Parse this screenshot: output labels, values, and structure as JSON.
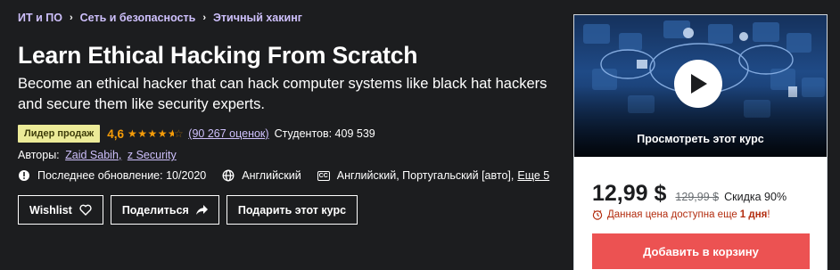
{
  "breadcrumb": [
    "ИТ и ПО",
    "Сеть и безопасность",
    "Этичный хакинг"
  ],
  "course": {
    "title": "Learn Ethical Hacking From Scratch",
    "subtitle": "Become an ethical hacker that can hack computer systems like black hat hackers and secure them like security experts.",
    "badge": "Лидер продаж",
    "rating": "4,6",
    "rating_value": 4.6,
    "reviews": "(90 267 оценок)",
    "students": "Студентов: 409 539",
    "authors_label": "Авторы:",
    "authors": [
      "Zaid Sabih,",
      "z Security"
    ],
    "last_update": "Последнее обновление: 10/2020",
    "language": "Английский",
    "captions": "Английский, Португальский [авто],",
    "captions_more": "Еще 5"
  },
  "buttons": {
    "wishlist": "Wishlist",
    "share": "Поделиться",
    "gift": "Подарить этот курс"
  },
  "card": {
    "preview_label": "Просмотреть этот курс",
    "price": "12,99 $",
    "old_price": "129,99 $",
    "discount": "Скидка 90%",
    "timer_text": "Данная цена доступна еще",
    "timer_bold": "1 дня",
    "timer_end": "!",
    "add_to_cart": "Добавить в корзину"
  },
  "colors": {
    "background": "#1c1d1f",
    "link_purple": "#cec0fc",
    "star_orange": "#f69c08",
    "badge_yellow": "#eceb98",
    "cart_red": "#ec5252",
    "timer_red": "#b32d0f"
  },
  "icons": [
    "chevron-right-icon",
    "star-icon",
    "alert-icon",
    "globe-icon",
    "captions-icon",
    "heart-icon",
    "share-arrow-icon",
    "clock-icon",
    "play-icon"
  ]
}
